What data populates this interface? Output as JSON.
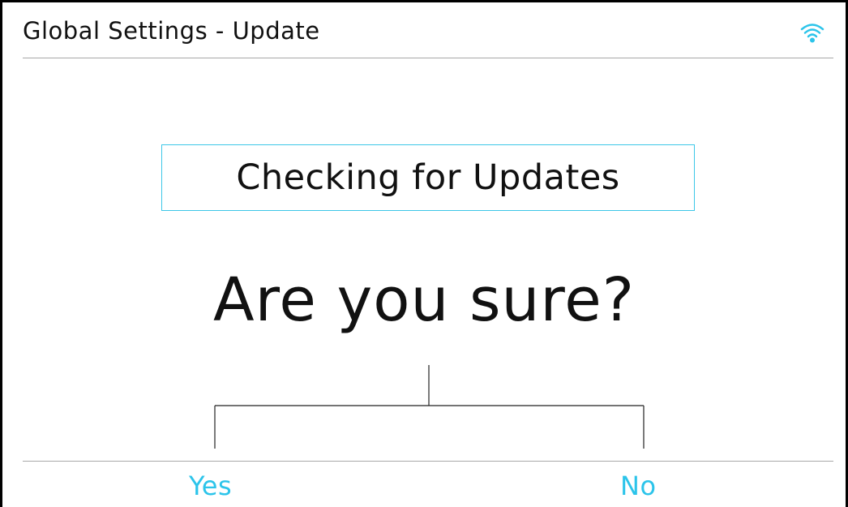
{
  "header": {
    "title": "Global Settings - Update",
    "wifi_icon": "wifi-icon"
  },
  "status": {
    "text": "Checking for Updates"
  },
  "dialog": {
    "prompt": "Are you sure?",
    "yes_label": "Yes",
    "no_label": "No"
  },
  "colors": {
    "accent": "#2cc4ea",
    "box_border": "#3cc7e8",
    "divider": "#a8a8a8",
    "text": "#111111"
  }
}
